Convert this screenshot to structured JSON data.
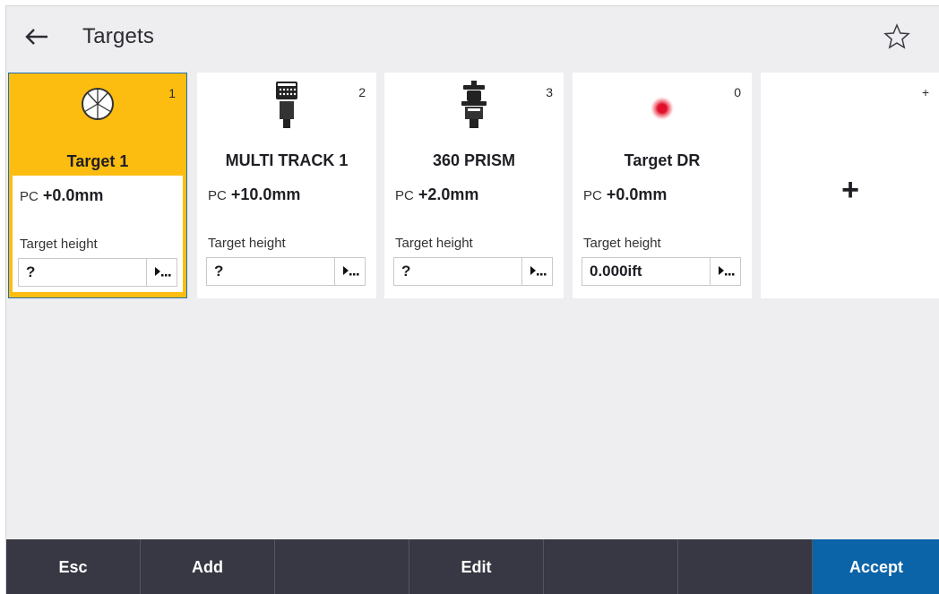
{
  "header": {
    "title": "Targets",
    "back_icon": "arrow-left-icon",
    "favorite_icon": "star-outline-icon"
  },
  "colors": {
    "selected_card": "#fdbd10",
    "selected_border": "#1f6fb2",
    "bottom_bar": "#383844",
    "accept": "#0b63a8",
    "laser_dot": "#e0102a"
  },
  "targets": [
    {
      "name": "Target 1",
      "count": "1",
      "icon": "prism-circle-icon",
      "pc_prefix": "PC",
      "pc_value": "+0.0mm",
      "height_label": "Target height",
      "height_value": "?",
      "selected": true
    },
    {
      "name": "MULTI TRACK 1",
      "count": "2",
      "icon": "multitrack-prism-icon",
      "pc_prefix": "PC",
      "pc_value": "+10.0mm",
      "height_label": "Target height",
      "height_value": "?",
      "selected": false
    },
    {
      "name": "360 PRISM",
      "count": "3",
      "icon": "prism-360-icon",
      "pc_prefix": "PC",
      "pc_value": "+2.0mm",
      "height_label": "Target height",
      "height_value": "?",
      "selected": false
    },
    {
      "name": "Target DR",
      "count": "0",
      "icon": "laser-dot-icon",
      "pc_prefix": "PC",
      "pc_value": "+0.0mm",
      "height_label": "Target height",
      "height_value": "0.000ift",
      "selected": false
    }
  ],
  "add_card": {
    "corner": "+",
    "plus": "+"
  },
  "bottom_bar": {
    "esc": "Esc",
    "add": "Add",
    "edit": "Edit",
    "accept": "Accept"
  }
}
